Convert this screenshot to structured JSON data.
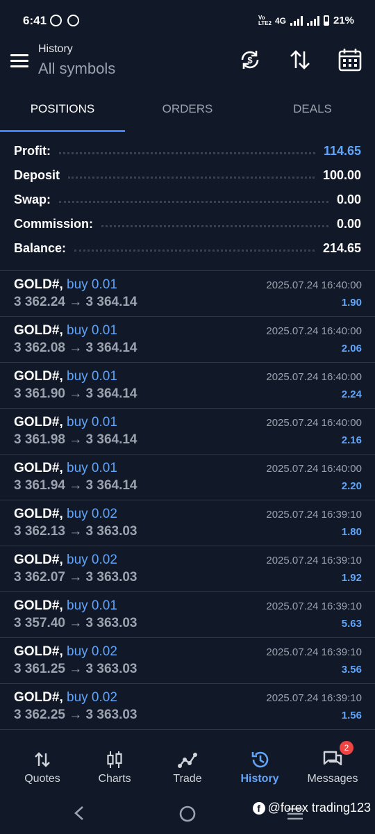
{
  "status_bar": {
    "time": "6:41",
    "network": "4G",
    "battery": "21%",
    "lte_label": "Vo LTE2"
  },
  "header": {
    "subtitle": "History",
    "title": "All symbols",
    "icons": [
      "sync-currency-icon",
      "sort-icon",
      "calendar-icon"
    ]
  },
  "tabs": [
    {
      "label": "POSITIONS",
      "active": true
    },
    {
      "label": "ORDERS",
      "active": false
    },
    {
      "label": "DEALS",
      "active": false
    }
  ],
  "summary": {
    "profit_label": "Profit:",
    "profit": "114.65",
    "deposit_label": "Deposit",
    "deposit": "100.00",
    "swap_label": "Swap:",
    "swap": "0.00",
    "commission_label": "Commission:",
    "commission": "0.00",
    "balance_label": "Balance:",
    "balance": "214.65"
  },
  "arrow": "→",
  "deals": [
    {
      "symbol": "GOLD#,",
      "side": "buy 0.01",
      "open": "3 362.24",
      "close": "3 364.14",
      "time": "2025.07.24 16:40:00",
      "profit": "1.90"
    },
    {
      "symbol": "GOLD#,",
      "side": "buy 0.01",
      "open": "3 362.08",
      "close": "3 364.14",
      "time": "2025.07.24 16:40:00",
      "profit": "2.06"
    },
    {
      "symbol": "GOLD#,",
      "side": "buy 0.01",
      "open": "3 361.90",
      "close": "3 364.14",
      "time": "2025.07.24 16:40:00",
      "profit": "2.24"
    },
    {
      "symbol": "GOLD#,",
      "side": "buy 0.01",
      "open": "3 361.98",
      "close": "3 364.14",
      "time": "2025.07.24 16:40:00",
      "profit": "2.16"
    },
    {
      "symbol": "GOLD#,",
      "side": "buy 0.01",
      "open": "3 361.94",
      "close": "3 364.14",
      "time": "2025.07.24 16:40:00",
      "profit": "2.20"
    },
    {
      "symbol": "GOLD#,",
      "side": "buy 0.02",
      "open": "3 362.13",
      "close": "3 363.03",
      "time": "2025.07.24 16:39:10",
      "profit": "1.80"
    },
    {
      "symbol": "GOLD#,",
      "side": "buy 0.02",
      "open": "3 362.07",
      "close": "3 363.03",
      "time": "2025.07.24 16:39:10",
      "profit": "1.92"
    },
    {
      "symbol": "GOLD#,",
      "side": "buy 0.01",
      "open": "3 357.40",
      "close": "3 363.03",
      "time": "2025.07.24 16:39:10",
      "profit": "5.63"
    },
    {
      "symbol": "GOLD#,",
      "side": "buy 0.02",
      "open": "3 361.25",
      "close": "3 363.03",
      "time": "2025.07.24 16:39:10",
      "profit": "3.56"
    },
    {
      "symbol": "GOLD#,",
      "side": "buy 0.02",
      "open": "3 362.25",
      "close": "3 363.03",
      "time": "2025.07.24 16:39:10",
      "profit": "1.56"
    }
  ],
  "bottom_nav": [
    {
      "label": "Quotes",
      "icon": "quotes-icon",
      "active": false
    },
    {
      "label": "Charts",
      "icon": "charts-icon",
      "active": false
    },
    {
      "label": "Trade",
      "icon": "trade-icon",
      "active": false
    },
    {
      "label": "History",
      "icon": "history-icon",
      "active": true
    },
    {
      "label": "Messages",
      "icon": "messages-icon",
      "active": false,
      "badge": "2"
    }
  ],
  "watermark": "@forex trading123",
  "colors": {
    "background": "#111827",
    "accent": "#3b82f6",
    "value_blue": "#60a5fa",
    "badge": "#ef4444"
  }
}
